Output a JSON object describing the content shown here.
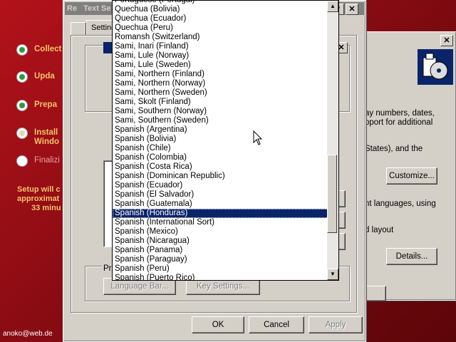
{
  "setup": {
    "steps": [
      {
        "label": "Collect",
        "state": "done"
      },
      {
        "label": "Upda",
        "state": "done"
      },
      {
        "label": "Prepa",
        "state": "done"
      },
      {
        "label": "Install\nWindo",
        "state": "active"
      },
      {
        "label": "Finalizi",
        "state": "pending"
      }
    ],
    "time_line1": "Setup will c",
    "time_line2": "approximat",
    "time_line3": "33 minu",
    "watermark": "anoko@web.de"
  },
  "dialog": {
    "title": "Text Se",
    "tab": "Setting",
    "prefix": "Re",
    "ok": "OK",
    "cancel": "Cancel",
    "apply": "Apply",
    "language_bar": "Language Bar...",
    "key_settings": "Key Settings...",
    "prefs_label": "Pre"
  },
  "regional": {
    "text_numbers": "ay numbers, dates,",
    "text_support": "pport for additional",
    "text_states": "States), and the",
    "customize": "Customize...",
    "text_languages": "nt languages, using",
    "text_layout": "d layout",
    "details": "Details..."
  },
  "dropdown": {
    "items": [
      "Portuguese (Portugal)",
      "Quechua (Bolivia)",
      "Quechua (Ecuador)",
      "Quechua (Peru)",
      "Romansh (Switzerland)",
      "Sami, Inari (Finland)",
      "Sami, Lule (Norway)",
      "Sami, Lule (Sweden)",
      "Sami, Northern (Finland)",
      "Sami, Northern (Norway)",
      "Sami, Northern (Sweden)",
      "Sami, Skolt (Finland)",
      "Sami, Southern (Norway)",
      "Sami, Southern (Sweden)",
      "Spanish (Argentina)",
      "Spanish (Bolivia)",
      "Spanish (Chile)",
      "Spanish (Colombia)",
      "Spanish (Costa Rica)",
      "Spanish (Dominican Republic)",
      "Spanish (Ecuador)",
      "Spanish (El Salvador)",
      "Spanish (Guatemala)",
      "Spanish (Honduras)",
      "Spanish (International Sort)",
      "Spanish (Mexico)",
      "Spanish (Nicaragua)",
      "Spanish (Panama)",
      "Spanish (Paraguay)",
      "Spanish (Peru)",
      "Spanish (Puerto Rico)"
    ],
    "selected": "Spanish (Honduras)"
  }
}
